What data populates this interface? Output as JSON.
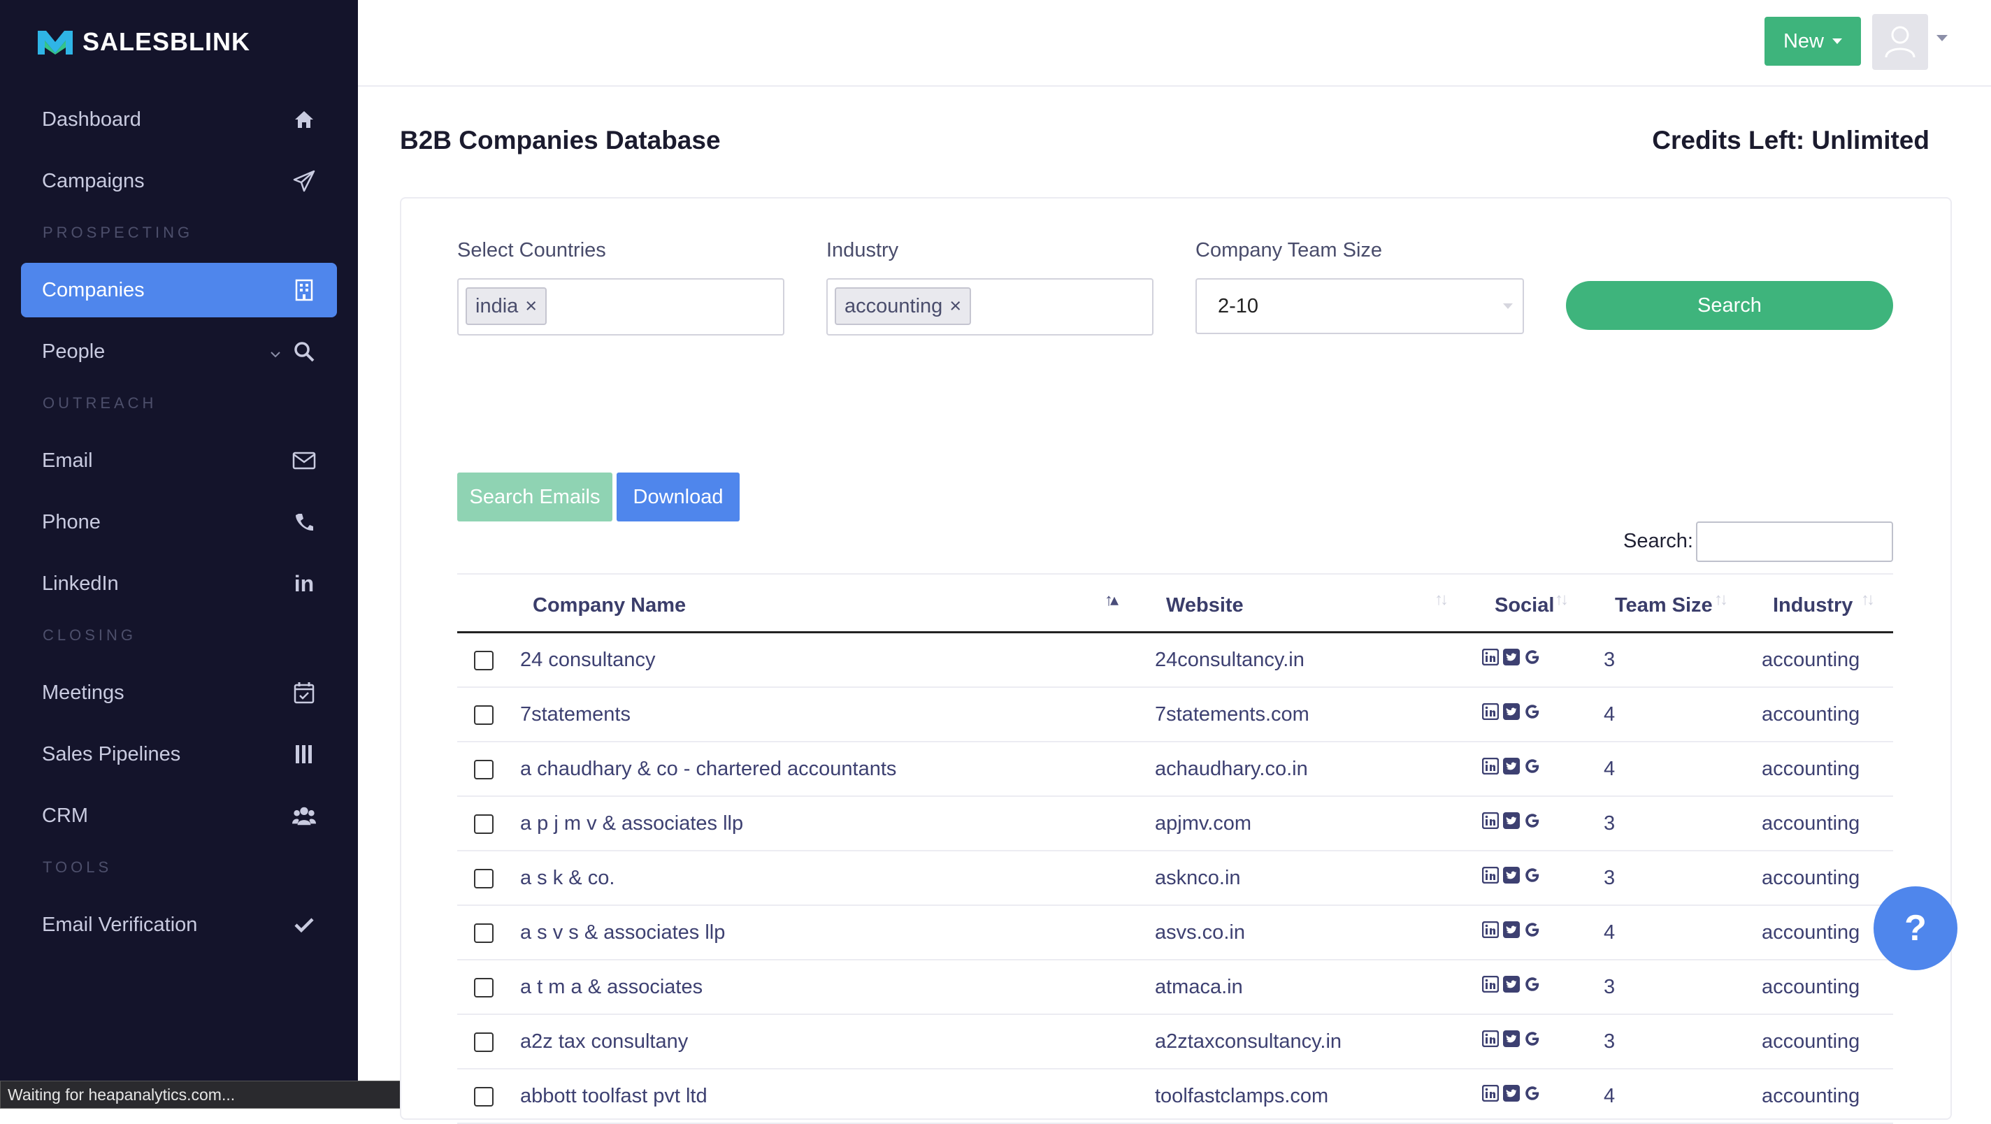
{
  "brand": {
    "name": "SALESBLINK"
  },
  "sidebar": {
    "items": [
      {
        "label": "Dashboard",
        "icon": "home-icon"
      },
      {
        "label": "Campaigns",
        "icon": "paper-plane-icon"
      },
      {
        "label": "Companies",
        "icon": "building-icon",
        "active": true
      },
      {
        "label": "People",
        "icon": "search-icon"
      },
      {
        "label": "Email",
        "icon": "envelope-icon"
      },
      {
        "label": "Phone",
        "icon": "phone-icon"
      },
      {
        "label": "LinkedIn",
        "icon": "linkedin-icon"
      },
      {
        "label": "Meetings",
        "icon": "calendar-check-icon"
      },
      {
        "label": "Sales Pipelines",
        "icon": "columns-icon"
      },
      {
        "label": "CRM",
        "icon": "users-icon"
      },
      {
        "label": "Email Verification",
        "icon": "check-icon"
      }
    ],
    "sections": [
      "PROSPECTING",
      "OUTREACH",
      "CLOSING",
      "TOOLS"
    ]
  },
  "statusbar": {
    "text": "Waiting for heapanalytics.com..."
  },
  "header": {
    "new_label": "New"
  },
  "page": {
    "title": "B2B Companies Database",
    "credits": "Credits Left: Unlimited"
  },
  "filters": {
    "countries_label": "Select Countries",
    "countries_tag": "india",
    "industry_label": "Industry",
    "industry_tag": "accounting",
    "team_size_label": "Company Team Size",
    "team_size_value": "2-10",
    "search_label": "Search",
    "tag_remove": "×"
  },
  "actions": {
    "search_emails": "Search Emails",
    "download": "Download"
  },
  "table": {
    "search_label": "Search:",
    "search_value": "",
    "columns": [
      "Company Name",
      "Website",
      "Social",
      "Team Size",
      "Industry"
    ],
    "rows": [
      {
        "name": "24 consultancy",
        "website": "24consultancy.in",
        "team_size": "3",
        "industry": "accounting"
      },
      {
        "name": "7statements",
        "website": "7statements.com",
        "team_size": "4",
        "industry": "accounting"
      },
      {
        "name": "a chaudhary & co - chartered accountants",
        "website": "achaudhary.co.in",
        "team_size": "4",
        "industry": "accounting"
      },
      {
        "name": "a p j m v & associates llp",
        "website": "apjmv.com",
        "team_size": "3",
        "industry": "accounting"
      },
      {
        "name": "a s k & co.",
        "website": "asknco.in",
        "team_size": "3",
        "industry": "accounting"
      },
      {
        "name": "a s v s & associates llp",
        "website": "asvs.co.in",
        "team_size": "4",
        "industry": "accounting"
      },
      {
        "name": "a t m a & associates",
        "website": "atmaca.in",
        "team_size": "3",
        "industry": "accounting"
      },
      {
        "name": "a2z tax consultany",
        "website": "a2ztaxconsultancy.in",
        "team_size": "3",
        "industry": "accounting"
      },
      {
        "name": "abbott toolfast pvt ltd",
        "website": "toolfastclamps.com",
        "team_size": "4",
        "industry": "accounting"
      }
    ]
  },
  "help": {
    "label": "?"
  },
  "colors": {
    "sidebar": "#14142b",
    "accent_blue": "#4f86ec",
    "accent_green": "#3eb47c"
  }
}
